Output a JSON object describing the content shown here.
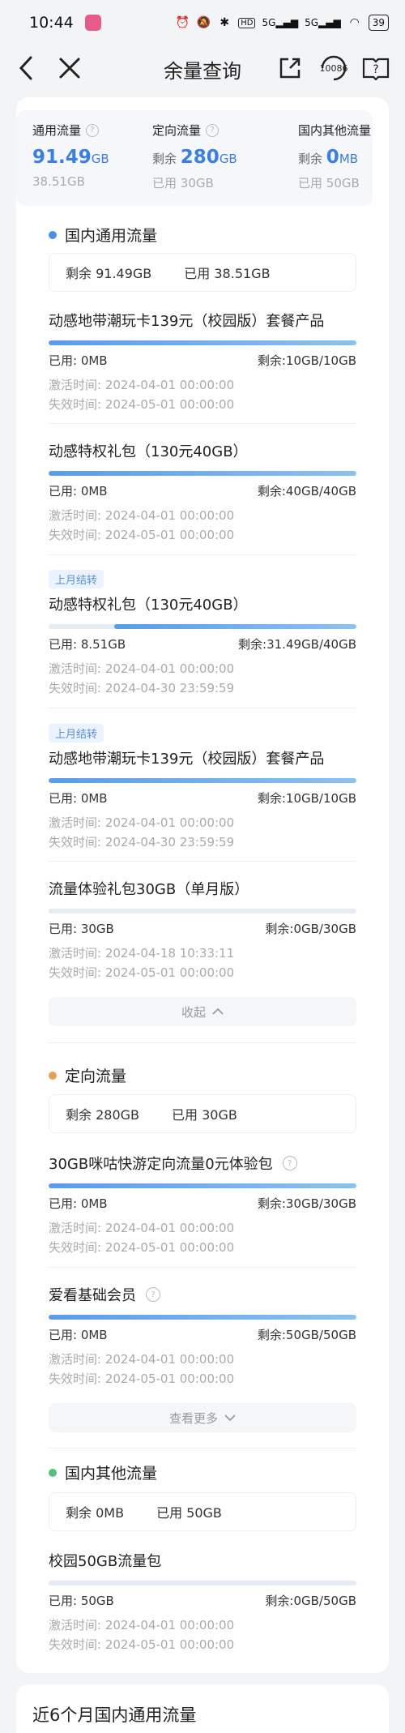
{
  "status_bar": {
    "time": "10:44",
    "hd": "HD",
    "signal1": "5G",
    "signal2": "5G",
    "battery": "39"
  },
  "nav": {
    "title": "余量查询",
    "hotline": "10086"
  },
  "summary": {
    "general": {
      "title": "通用流量",
      "remain_value": "91.49",
      "remain_unit": "GB",
      "used": "38.51GB"
    },
    "directed": {
      "title": "定向流量",
      "remain_label": "剩余",
      "remain_value": "280",
      "remain_unit": "GB",
      "used_label": "已用",
      "used": "30GB"
    },
    "other": {
      "title": "国内其他流量",
      "remain_label": "剩余",
      "remain_value": "0",
      "remain_unit": "MB",
      "used_label": "已用",
      "used": "50GB"
    }
  },
  "sections": [
    {
      "title": "国内通用流量",
      "color": "#4f8ee8",
      "box_remain": "剩余 91.49GB",
      "box_used": "已用 38.51GB",
      "items": [
        {
          "tag": "",
          "title": "动感地带潮玩卡139元（校园版）套餐产品",
          "used": "已用: 0MB",
          "remain": "剩余:10GB/10GB",
          "fraction": 1.0,
          "activate": "激活时间: 2024-04-01 00:00:00",
          "expire": "失效时间: 2024-05-01 00:00:00"
        },
        {
          "tag": "",
          "title": "动感特权礼包（130元40GB）",
          "used": "已用: 0MB",
          "remain": "剩余:40GB/40GB",
          "fraction": 1.0,
          "activate": "激活时间: 2024-04-01 00:00:00",
          "expire": "失效时间: 2024-05-01 00:00:00"
        },
        {
          "tag": "上月结转",
          "title": "动感特权礼包（130元40GB）",
          "used": "已用: 8.51GB",
          "remain": "剩余:31.49GB/40GB",
          "fraction": 0.787,
          "activate": "激活时间: 2024-04-01 00:00:00",
          "expire": "失效时间: 2024-04-30 23:59:59"
        },
        {
          "tag": "上月结转",
          "title": "动感地带潮玩卡139元（校园版）套餐产品",
          "used": "已用: 0MB",
          "remain": "剩余:10GB/10GB",
          "fraction": 1.0,
          "activate": "激活时间: 2024-04-01 00:00:00",
          "expire": "失效时间: 2024-04-30 23:59:59"
        },
        {
          "tag": "",
          "title": "流量体验礼包30GB（单月版）",
          "used": "已用: 30GB",
          "remain": "剩余:0GB/30GB",
          "fraction": 0.0,
          "activate": "激活时间: 2024-04-18 10:33:11",
          "expire": "失效时间: 2024-05-01 00:00:00"
        }
      ],
      "toggle": "收起"
    },
    {
      "title": "定向流量",
      "color": "#e8a04f",
      "box_remain": "剩余 280GB",
      "box_used": "已用 30GB",
      "items": [
        {
          "tag": "",
          "title": "30GB咪咕快游定向流量0元体验包",
          "used": "已用: 0MB",
          "remain": "剩余:30GB/30GB",
          "fraction": 1.0,
          "activate": "激活时间: 2024-04-01 00:00:00",
          "expire": "失效时间: 2024-05-01 00:00:00"
        },
        {
          "tag": "",
          "title": "爱看基础会员",
          "used": "已用: 0MB",
          "remain": "剩余:50GB/50GB",
          "fraction": 1.0,
          "activate": "激活时间: 2024-04-01 00:00:00",
          "expire": "失效时间: 2024-05-01 00:00:00"
        }
      ],
      "toggle": "查看更多"
    },
    {
      "title": "国内其他流量",
      "color": "#52c27a",
      "box_remain": "剩余 0MB",
      "box_used": "已用 50GB",
      "items": [
        {
          "tag": "",
          "title": "校园50GB流量包",
          "used": "已用: 50GB",
          "remain": "剩余:0GB/50GB",
          "fraction": 0.0,
          "activate": "激活时间: 2024-04-01 00:00:00",
          "expire": "失效时间: 2024-05-01 00:00:00"
        }
      ]
    }
  ],
  "bottom": {
    "title": "近6个月国内通用流量"
  }
}
